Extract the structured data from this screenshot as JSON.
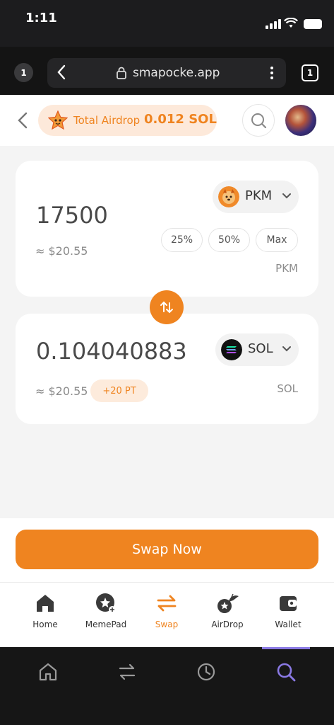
{
  "status_bar": {
    "time": "1:11"
  },
  "browser": {
    "tab_count_left": "1",
    "url": "smapocke.app",
    "tab_count_right": "1"
  },
  "header": {
    "airdrop_label": "Total Airdrop",
    "airdrop_amount": "0.012 SOL"
  },
  "from_card": {
    "amount": "17500",
    "usd": "≈ $20.55",
    "token": "PKM",
    "unit": "PKM",
    "percent_buttons": [
      "25%",
      "50%",
      "Max"
    ]
  },
  "to_card": {
    "amount": "0.104040883",
    "usd": "≈ $20.55",
    "token": "SOL",
    "unit": "SOL",
    "points_badge": "+20 PT"
  },
  "swap_button_label": "Swap Now",
  "nav": {
    "items": [
      {
        "label": "Home",
        "icon": "home-icon"
      },
      {
        "label": "MemePad",
        "icon": "memepad-icon"
      },
      {
        "label": "Swap",
        "icon": "swap-icon",
        "active": true
      },
      {
        "label": "AirDrop",
        "icon": "airdrop-icon"
      },
      {
        "label": "Wallet",
        "icon": "wallet-icon"
      }
    ]
  },
  "colors": {
    "accent": "#ef8420",
    "accent_soft": "#fde9da",
    "browser_indicator": "#8a79e4"
  }
}
